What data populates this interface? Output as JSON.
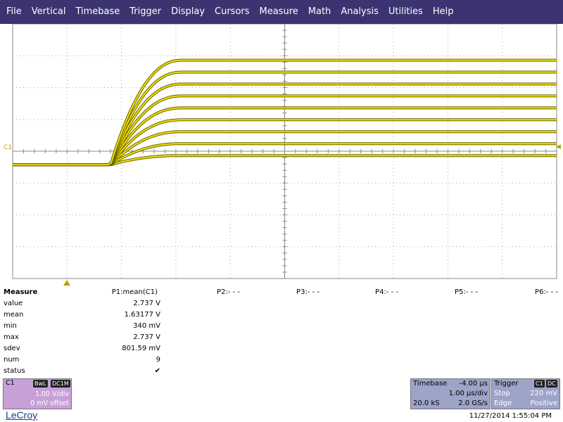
{
  "menu": [
    "File",
    "Vertical",
    "Timebase",
    "Trigger",
    "Display",
    "Cursors",
    "Measure",
    "Math",
    "Analysis",
    "Utilities",
    "Help"
  ],
  "channel_marker": "C1",
  "colors": {
    "trace": "#f0e000",
    "trace_shadow": "#6a6400",
    "menubar": "#3b3470",
    "grid": "#999999",
    "c1_panel": "#c8a0d8",
    "timebase_panel": "#9da4c8"
  },
  "chart_data": {
    "type": "line",
    "description_note": "",
    "x_unit": "µs",
    "y_unit": "V",
    "xlim": [
      -4,
      6
    ],
    "ylim": [
      -4.2,
      5.2
    ],
    "rise_start": -2.2,
    "rise_time": 1.3,
    "series_levels": [
      0.34,
      0.78,
      1.22,
      1.66,
      2.1,
      2.54,
      2.98,
      3.42,
      3.86
    ]
  },
  "measure": {
    "header": "Measure",
    "params": [
      "P1:mean(C1)",
      "P2:- - -",
      "P3:- - -",
      "P4:- - -",
      "P5:- - -",
      "P6:- - -"
    ],
    "rows": [
      {
        "label": "value",
        "p1": "2.737 V"
      },
      {
        "label": "mean",
        "p1": "1.63177 V"
      },
      {
        "label": "min",
        "p1": "340 mV"
      },
      {
        "label": "max",
        "p1": "2.737 V"
      },
      {
        "label": "sdev",
        "p1": "801.59 mV"
      },
      {
        "label": "num",
        "p1": "9"
      },
      {
        "label": "status",
        "p1": "✔"
      }
    ]
  },
  "c1_panel": {
    "name": "C1",
    "tag1": "BwL",
    "tag2": "DC1M",
    "vdiv": "1.00 V/div",
    "offset": "0 mV offset"
  },
  "timebase_panel": {
    "title": "Timebase",
    "delay": "-4.00 µs",
    "tdiv": "1.00 µs/div",
    "samples": "20.0 kS",
    "rate": "2.0 GS/s"
  },
  "trigger_panel": {
    "title": "Trigger",
    "tag1": "C1",
    "tag2": "DC",
    "mode": "Stop",
    "level": "220 mV",
    "type": "Edge",
    "slope": "Positive"
  },
  "brand": "LeCroy",
  "datetime": "11/27/2014 1:55:04 PM"
}
